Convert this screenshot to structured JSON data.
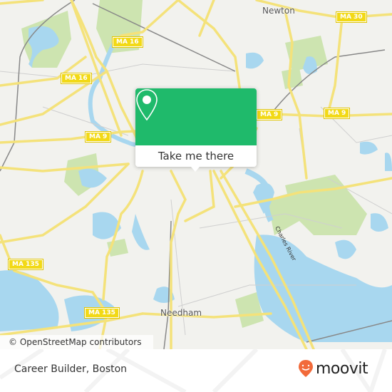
{
  "map": {
    "places": [
      {
        "name": "Newton"
      },
      {
        "name": "Needham"
      }
    ],
    "route_shields": [
      "MA 16",
      "MA 16",
      "MA 9",
      "MA 9",
      "MA 9",
      "MA 30",
      "MA 135",
      "MA 135"
    ],
    "river_label": "Charles River",
    "attribution": "© OpenStreetMap contributors",
    "colors": {
      "land": "#f2f2ee",
      "water": "#a8d7ef",
      "park": "#cde4b0",
      "road": "#f4e27a",
      "shield": "#f2d916"
    }
  },
  "popup": {
    "icon": "location-pin-icon",
    "button_label": "Take me there",
    "accent": "#1fba6b"
  },
  "footer": {
    "title": "Career Builder, Boston",
    "brand": "moovit",
    "brand_color": "#f26a3a"
  }
}
